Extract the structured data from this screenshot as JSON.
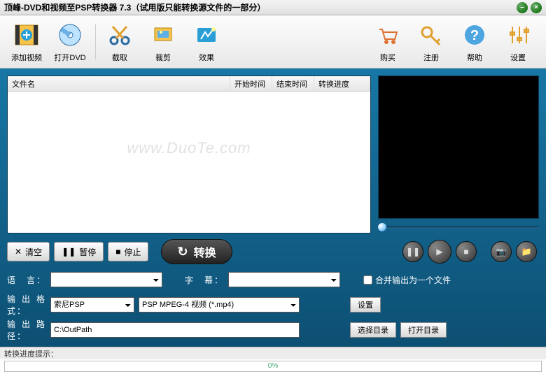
{
  "title": "顶峰-DVD和视频至PSP转换器 7.3（试用版只能转换源文件的一部分）",
  "window_buttons": {
    "min": "–",
    "close": "×"
  },
  "toolbar": {
    "add_video": "添加视频",
    "open_dvd": "打开DVD",
    "cut": "截取",
    "crop": "裁剪",
    "effect": "效果",
    "buy": "购买",
    "register": "注册",
    "help": "帮助",
    "settings": "设置"
  },
  "list_headers": {
    "filename": "文件名",
    "start": "开始时间",
    "end": "结束时间",
    "progress": "转换进度"
  },
  "watermark": "www.DuoTe.com",
  "controls": {
    "clear": "清空",
    "pause": "暂停",
    "stop": "停止",
    "convert": "转换"
  },
  "form": {
    "lang_label": "语　言：",
    "subtitle_label": "字　幕：",
    "merge_label": "合并输出为一个文件",
    "format_label": "输出格式：",
    "device": "索尼PSP",
    "format": "PSP MPEG-4 视频 (*.mp4)",
    "settings_btn": "设置",
    "path_label": "输出路径：",
    "path": "C:\\OutPath",
    "browse": "选择目录",
    "open_dir": "打开目录"
  },
  "status_label": "转换进度提示：",
  "progress_text": "0%"
}
